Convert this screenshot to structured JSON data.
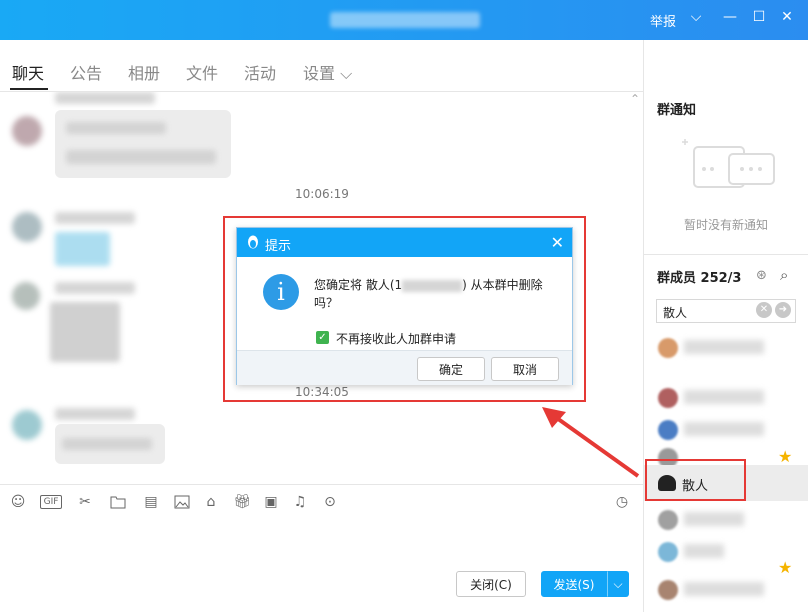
{
  "window": {
    "report_label": "举报",
    "minimize": "—",
    "maximize": "☐",
    "close": "✕",
    "dropdown": "⌵"
  },
  "tabs": [
    {
      "label": "聊天"
    },
    {
      "label": "公告"
    },
    {
      "label": "相册"
    },
    {
      "label": "文件"
    },
    {
      "label": "活动"
    },
    {
      "label": "设置 ⌵"
    }
  ],
  "chat": {
    "timestamps": [
      "10:06:19",
      "10:34:05"
    ]
  },
  "input": {
    "close_button": "关闭(C)",
    "send_button": "发送(S)",
    "send_dropdown": "⌵"
  },
  "sidebar": {
    "notice_title": "群通知",
    "notice_empty": "暂时没有新通知",
    "members_title": "群成员 252/3",
    "search_value": "散人",
    "highlighted_member": "散人"
  },
  "dialog": {
    "title": "提示",
    "message_prefix": "您确定将 散人(1",
    "message_suffix": ") 从本群中删除吗？",
    "checkbox_label": "不再接收此人加群申请",
    "confirm_button": "确定",
    "cancel_button": "取消"
  },
  "colors": {
    "accent": "#12a5f7",
    "highlight_box": "#e53935",
    "green": "#3fb34f"
  }
}
